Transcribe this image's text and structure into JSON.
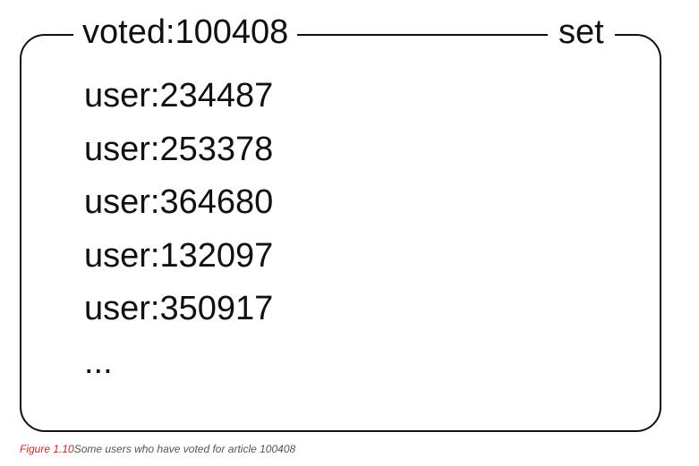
{
  "diagram": {
    "key": "voted:100408",
    "type": "set",
    "members": [
      "user:234487",
      "user:253378",
      "user:364680",
      "user:132097",
      "user:350917",
      "..."
    ]
  },
  "caption": {
    "figure_number": "Figure 1.10",
    "text": "Some users who have voted for article 100408"
  },
  "colors": {
    "border": "#111111",
    "text": "#111111",
    "figure_number": "#c62828",
    "caption_text": "#555555"
  }
}
